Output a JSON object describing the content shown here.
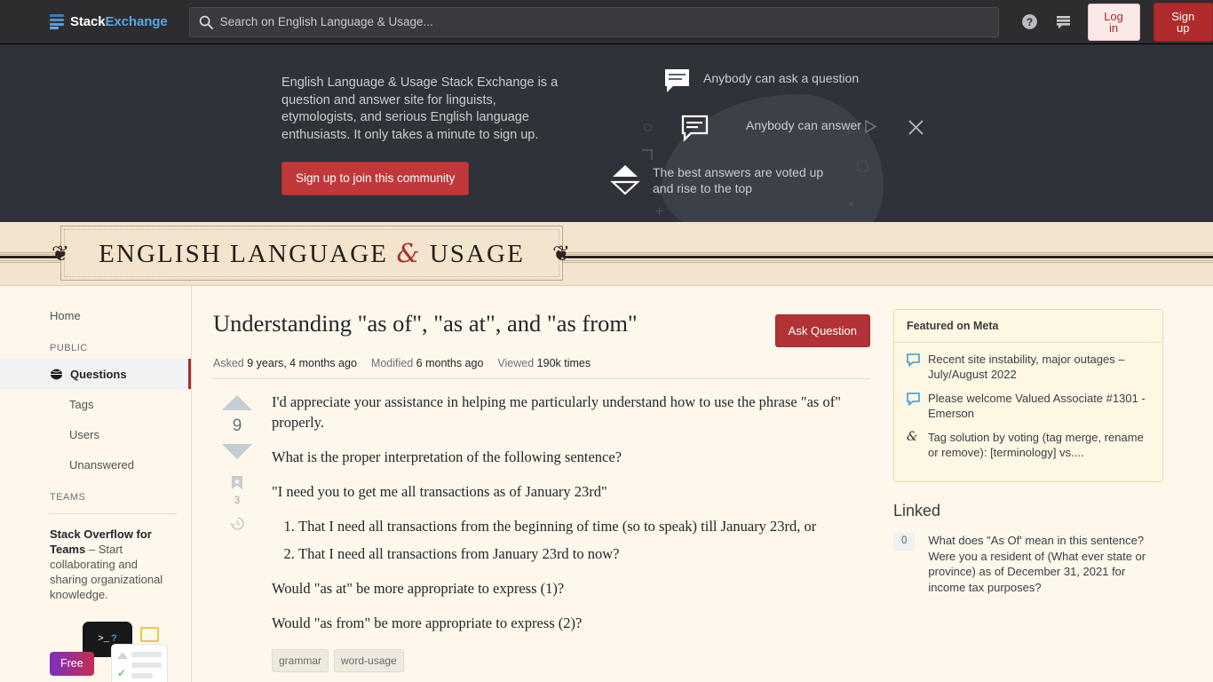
{
  "topnav": {
    "logo_stack": "Stack",
    "logo_exchange": "Exchange",
    "search_placeholder": "Search on English Language & Usage...",
    "search_value": "",
    "help_icon": "help-circle-icon",
    "inbox_icon": "stack-inbox-icon",
    "login_label": "Log in",
    "signup_label": "Sign up"
  },
  "hero": {
    "copy": "English Language & Usage Stack Exchange is a question and answer site for linguists, etymologists, and serious English language enthusiasts. It only takes a minute to sign up.",
    "cta_label": "Sign up to join this community",
    "features": [
      {
        "icon": "speech-bubble-filled-icon",
        "text": "Anybody can ask a question"
      },
      {
        "icon": "speech-bubble-outline-icon",
        "text": "Anybody can answer"
      },
      {
        "icon": "vote-arrows-icon",
        "text": "The best answers are voted up and rise to the top"
      }
    ],
    "play_icon": "play-triangle-icon",
    "close_icon": "close-x-icon"
  },
  "sitebar": {
    "title_part1": "ENGLISH LANGUAGE",
    "title_amp": "&",
    "title_part2": "USAGE",
    "ornament_left": "ornament-icon",
    "ornament_right": "ornament-icon"
  },
  "sidebar": {
    "home_label": "Home",
    "public_header": "PUBLIC",
    "items": [
      {
        "label": "Questions",
        "icon": "globe-icon",
        "active": true
      },
      {
        "label": "Tags",
        "icon": "",
        "active": false
      },
      {
        "label": "Users",
        "icon": "",
        "active": false
      },
      {
        "label": "Unanswered",
        "icon": "",
        "active": false
      }
    ],
    "teams_header": "TEAMS",
    "ad_title": "Stack Overflow for Teams",
    "ad_body": " – Start collaborating and sharing organizational knowledge.",
    "ad_badge": "Free",
    "ad_terminal": ">_",
    "ad_terminal_q": "?"
  },
  "question": {
    "title": "Understanding \"as of\", \"as at\", and \"as from\"",
    "ask_button": "Ask Question",
    "meta": [
      {
        "label": "Asked",
        "value": "9 years, 4 months ago"
      },
      {
        "label": "Modified",
        "value": "6 months ago"
      },
      {
        "label": "Viewed",
        "value": "190k times"
      }
    ],
    "vote_count": "9",
    "bookmark_count": "3",
    "bookmark_icon": "bookmark-icon",
    "history_icon": "history-clock-icon",
    "upvote_icon": "arrow-up-icon",
    "downvote_icon": "arrow-down-icon",
    "paragraphs": [
      "I'd appreciate your assistance in helping me particularly understand how to use the phrase \"as of\" properly.",
      "What is the proper interpretation of the following sentence?",
      "\"I need you to get me all transactions as of January 23rd\""
    ],
    "list_items": [
      "That I need all transactions from the beginning of time (so to speak) till January 23rd, or",
      "That I need all transactions from January 23rd to now?"
    ],
    "closing_paragraphs": [
      "Would \"as at\" be more appropriate to express (1)?",
      "Would \"as from\" be more appropriate to express (2)?"
    ],
    "tags": [
      "grammar",
      "word-usage"
    ]
  },
  "meta_sidebar": {
    "featured_header": "Featured on Meta",
    "featured_items": [
      {
        "icon": "speech-bubble-blue-icon",
        "text": "Recent site instability, major outages – July/August 2022"
      },
      {
        "icon": "speech-bubble-blue-icon",
        "text": "Please welcome Valued Associate #1301 - Emerson"
      },
      {
        "icon": "ampersand-icon",
        "text": "Tag solution by voting (tag merge, rename or remove): [terminology] vs...."
      }
    ],
    "linked_header": "Linked",
    "linked_items": [
      {
        "score": "0",
        "text": "What does \"As Of' mean in this sentence? Were you a resident of (What ever state or province) as of December 31, 2021 for income tax purposes?"
      }
    ]
  },
  "colors": {
    "accent_red": "#b02b2c",
    "link_blue": "#3b9bd6",
    "page_bg": "#fdf7ec",
    "dark_nav": "#2d2d2f",
    "hero_bg": "#2f3238",
    "sitebar_bg": "#f2e4cd"
  }
}
